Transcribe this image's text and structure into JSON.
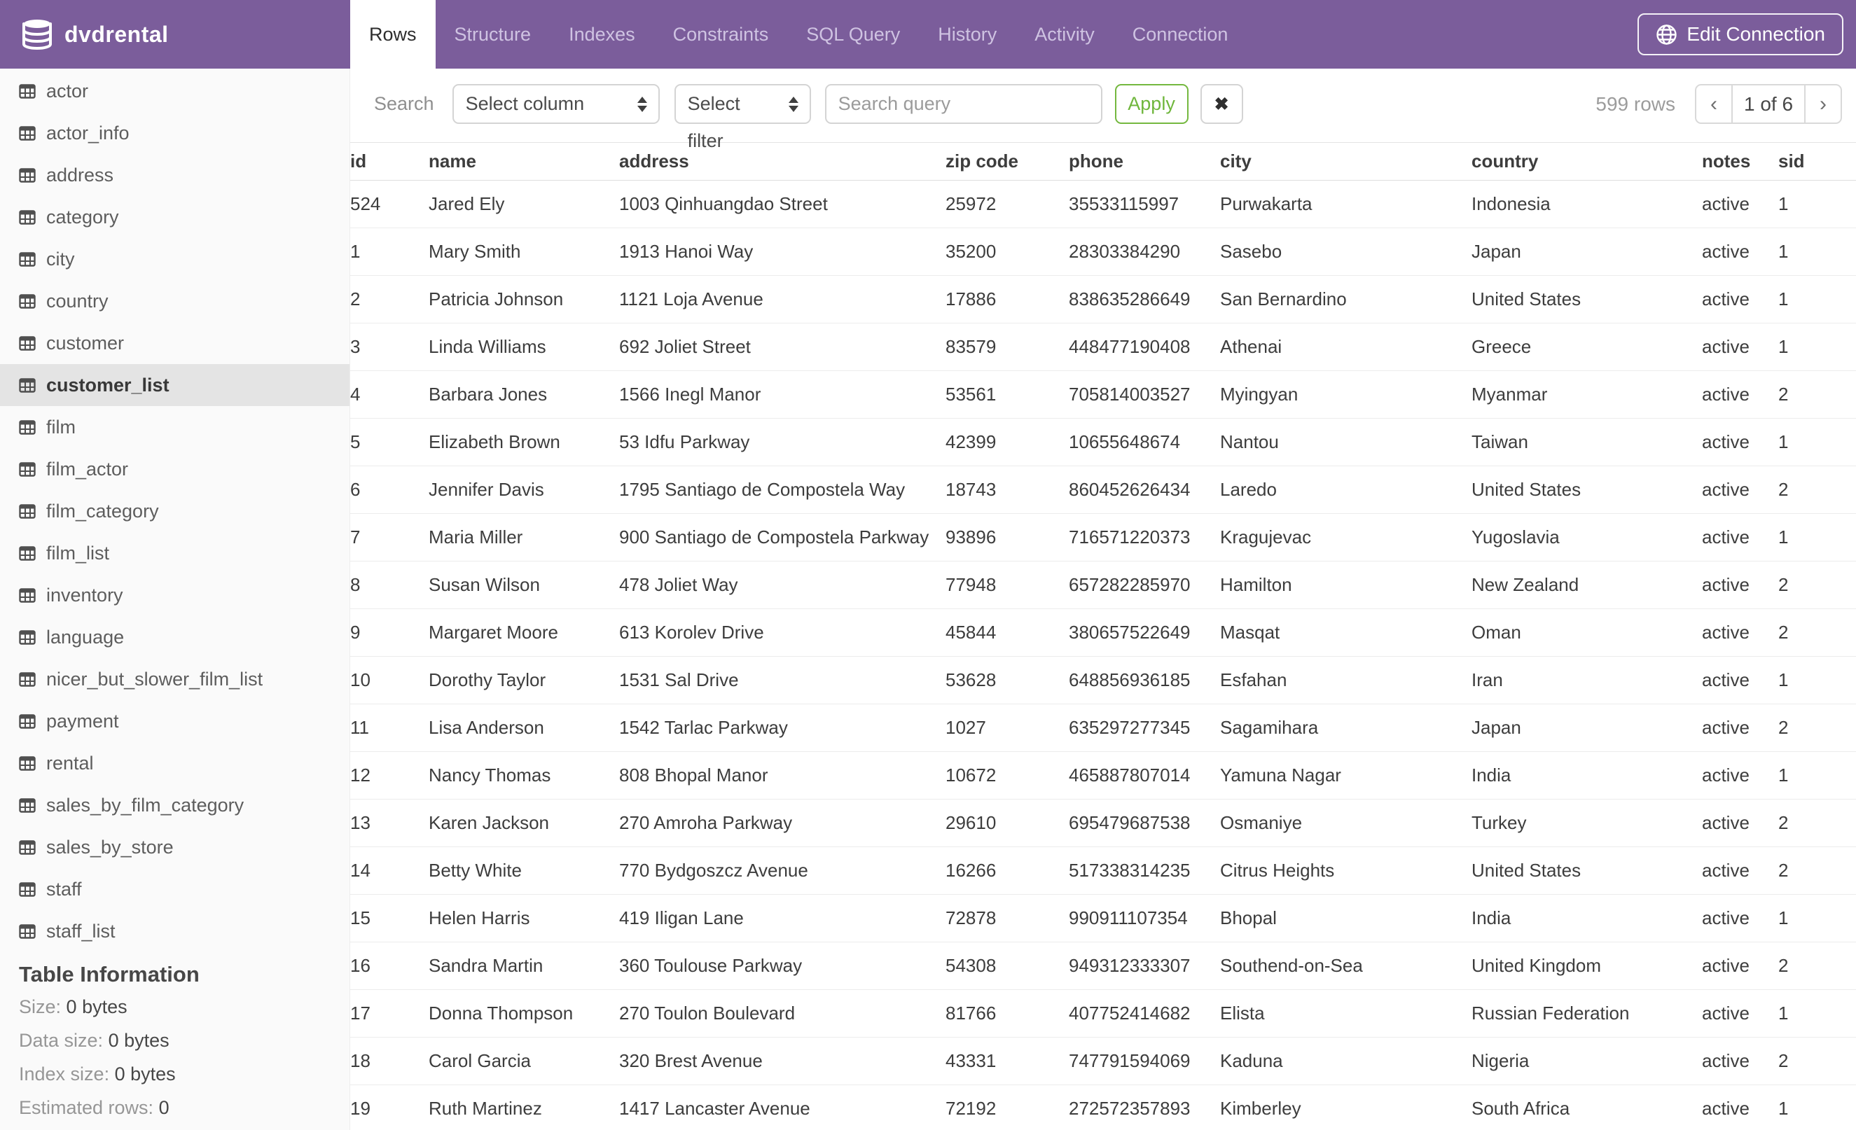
{
  "header": {
    "title": "dvdrental",
    "tabs": [
      {
        "label": "Rows",
        "active": true
      },
      {
        "label": "Structure",
        "active": false
      },
      {
        "label": "Indexes",
        "active": false
      },
      {
        "label": "Constraints",
        "active": false
      },
      {
        "label": "SQL Query",
        "active": false
      },
      {
        "label": "History",
        "active": false
      },
      {
        "label": "Activity",
        "active": false
      },
      {
        "label": "Connection",
        "active": false
      }
    ],
    "edit_connection_label": "Edit Connection",
    "accent_color": "#7b5d9b"
  },
  "sidebar": {
    "tables": [
      {
        "name": "actor",
        "selected": false
      },
      {
        "name": "actor_info",
        "selected": false
      },
      {
        "name": "address",
        "selected": false
      },
      {
        "name": "category",
        "selected": false
      },
      {
        "name": "city",
        "selected": false
      },
      {
        "name": "country",
        "selected": false
      },
      {
        "name": "customer",
        "selected": false
      },
      {
        "name": "customer_list",
        "selected": true
      },
      {
        "name": "film",
        "selected": false
      },
      {
        "name": "film_actor",
        "selected": false
      },
      {
        "name": "film_category",
        "selected": false
      },
      {
        "name": "film_list",
        "selected": false
      },
      {
        "name": "inventory",
        "selected": false
      },
      {
        "name": "language",
        "selected": false
      },
      {
        "name": "nicer_but_slower_film_list",
        "selected": false
      },
      {
        "name": "payment",
        "selected": false
      },
      {
        "name": "rental",
        "selected": false
      },
      {
        "name": "sales_by_film_category",
        "selected": false
      },
      {
        "name": "sales_by_store",
        "selected": false
      },
      {
        "name": "staff",
        "selected": false
      },
      {
        "name": "staff_list",
        "selected": false
      }
    ],
    "table_information": {
      "heading": "Table Information",
      "rows": [
        {
          "label": "Size:",
          "value": "0 bytes"
        },
        {
          "label": "Data size:",
          "value": "0 bytes"
        },
        {
          "label": "Index size:",
          "value": "0 bytes"
        },
        {
          "label": "Estimated rows:",
          "value": "0"
        }
      ]
    }
  },
  "toolbar": {
    "search_label": "Search",
    "column_select_value": "Select column",
    "filter_select_value": "Select filter",
    "query_placeholder": "Search query",
    "apply_label": "Apply",
    "clear_label": "✖",
    "rows_count": "599 rows",
    "pagination": {
      "prev": "‹",
      "current": "1 of 6",
      "next": "›"
    }
  },
  "table": {
    "columns": [
      "id",
      "name",
      "address",
      "zip code",
      "phone",
      "city",
      "country",
      "notes",
      "sid"
    ],
    "rows": [
      [
        "524",
        "Jared Ely",
        "1003 Qinhuangdao Street",
        "25972",
        "35533115997",
        "Purwakarta",
        "Indonesia",
        "active",
        "1"
      ],
      [
        "1",
        "Mary Smith",
        "1913 Hanoi Way",
        "35200",
        "28303384290",
        "Sasebo",
        "Japan",
        "active",
        "1"
      ],
      [
        "2",
        "Patricia Johnson",
        "1121 Loja Avenue",
        "17886",
        "838635286649",
        "San Bernardino",
        "United States",
        "active",
        "1"
      ],
      [
        "3",
        "Linda Williams",
        "692 Joliet Street",
        "83579",
        "448477190408",
        "Athenai",
        "Greece",
        "active",
        "1"
      ],
      [
        "4",
        "Barbara Jones",
        "1566 Inegl Manor",
        "53561",
        "705814003527",
        "Myingyan",
        "Myanmar",
        "active",
        "2"
      ],
      [
        "5",
        "Elizabeth Brown",
        "53 Idfu Parkway",
        "42399",
        "10655648674",
        "Nantou",
        "Taiwan",
        "active",
        "1"
      ],
      [
        "6",
        "Jennifer Davis",
        "1795 Santiago de Compostela Way",
        "18743",
        "860452626434",
        "Laredo",
        "United States",
        "active",
        "2"
      ],
      [
        "7",
        "Maria Miller",
        "900 Santiago de Compostela Parkway",
        "93896",
        "716571220373",
        "Kragujevac",
        "Yugoslavia",
        "active",
        "1"
      ],
      [
        "8",
        "Susan Wilson",
        "478 Joliet Way",
        "77948",
        "657282285970",
        "Hamilton",
        "New Zealand",
        "active",
        "2"
      ],
      [
        "9",
        "Margaret Moore",
        "613 Korolev Drive",
        "45844",
        "380657522649",
        "Masqat",
        "Oman",
        "active",
        "2"
      ],
      [
        "10",
        "Dorothy Taylor",
        "1531 Sal Drive",
        "53628",
        "648856936185",
        "Esfahan",
        "Iran",
        "active",
        "1"
      ],
      [
        "11",
        "Lisa Anderson",
        "1542 Tarlac Parkway",
        "1027",
        "635297277345",
        "Sagamihara",
        "Japan",
        "active",
        "2"
      ],
      [
        "12",
        "Nancy Thomas",
        "808 Bhopal Manor",
        "10672",
        "465887807014",
        "Yamuna Nagar",
        "India",
        "active",
        "1"
      ],
      [
        "13",
        "Karen Jackson",
        "270 Amroha Parkway",
        "29610",
        "695479687538",
        "Osmaniye",
        "Turkey",
        "active",
        "2"
      ],
      [
        "14",
        "Betty White",
        "770 Bydgoszcz Avenue",
        "16266",
        "517338314235",
        "Citrus Heights",
        "United States",
        "active",
        "2"
      ],
      [
        "15",
        "Helen Harris",
        "419 Iligan Lane",
        "72878",
        "990911107354",
        "Bhopal",
        "India",
        "active",
        "1"
      ],
      [
        "16",
        "Sandra Martin",
        "360 Toulouse Parkway",
        "54308",
        "949312333307",
        "Southend-on-Sea",
        "United Kingdom",
        "active",
        "2"
      ],
      [
        "17",
        "Donna Thompson",
        "270 Toulon Boulevard",
        "81766",
        "407752414682",
        "Elista",
        "Russian Federation",
        "active",
        "1"
      ],
      [
        "18",
        "Carol Garcia",
        "320 Brest Avenue",
        "43331",
        "747791594069",
        "Kaduna",
        "Nigeria",
        "active",
        "2"
      ],
      [
        "19",
        "Ruth Martinez",
        "1417 Lancaster Avenue",
        "72192",
        "272572357893",
        "Kimberley",
        "South Africa",
        "active",
        "1"
      ]
    ]
  }
}
